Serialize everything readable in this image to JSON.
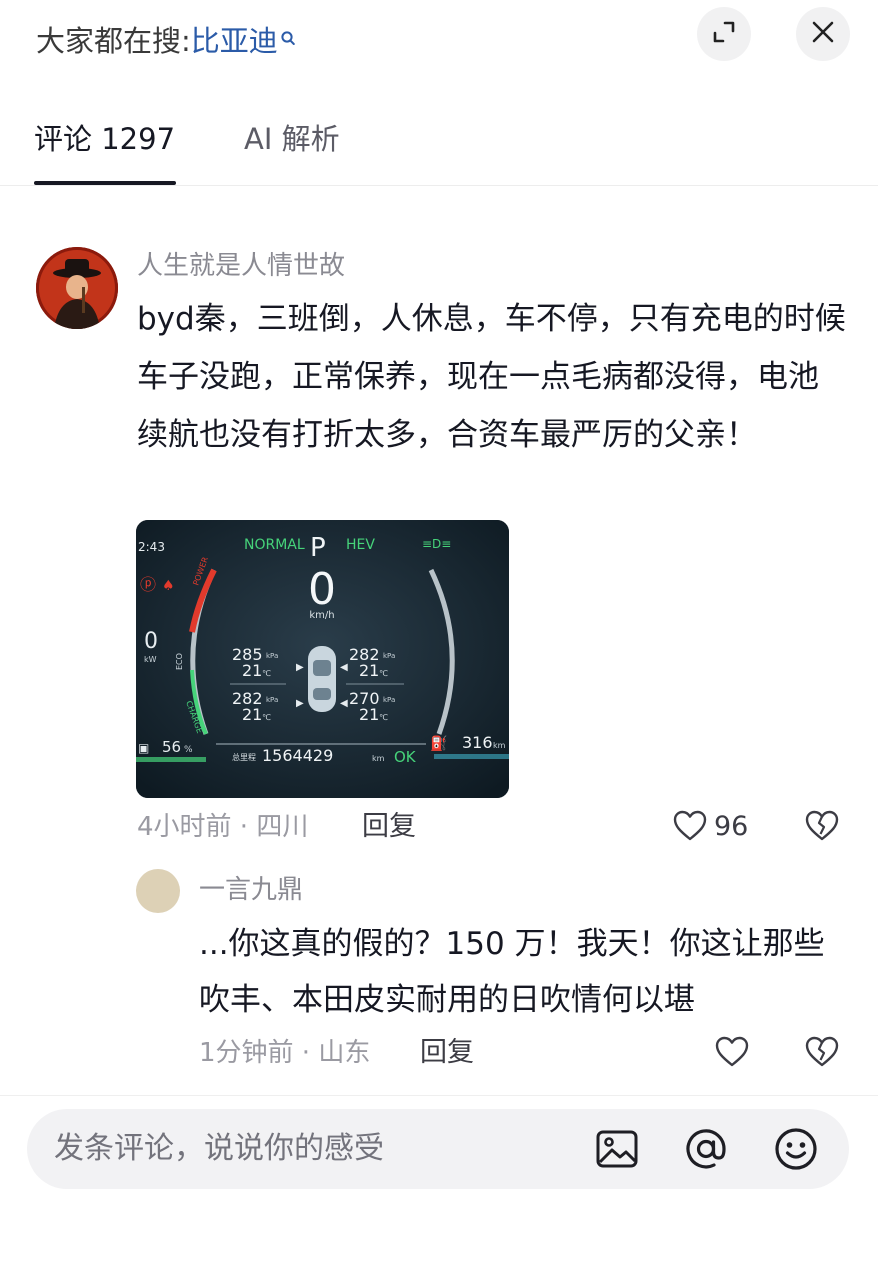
{
  "header": {
    "search_prefix": "大家都在搜:",
    "search_keyword": "比亚迪",
    "icons": [
      "search-icon",
      "expand-icon",
      "close-icon"
    ]
  },
  "tabs": [
    {
      "label": "评论 1297",
      "active": true
    },
    {
      "label": "AI 解析",
      "active": false
    }
  ],
  "comment": {
    "author": "人生就是人情世故",
    "text": "byd秦，三班倒，人休息，车不停，只有充电的时候车子没跑，正常保养，现在一点毛病都没得，电池续航也没有打折太多，合资车最严厉的父亲！",
    "meta": "4小时前 · 四川",
    "reply_label": "回复",
    "likes": "96",
    "dashboard": {
      "time": "2:43",
      "mode_left": "NORMAL",
      "gear": "P",
      "mode_right": "HEV",
      "speed": "0",
      "speed_unit": "km/h",
      "power": "0",
      "power_unit": "kW",
      "tires": [
        {
          "pressure": "285",
          "temp": "21"
        },
        {
          "pressure": "282",
          "temp": "21"
        },
        {
          "pressure": "282",
          "temp": "21"
        },
        {
          "pressure": "270",
          "temp": "21"
        }
      ],
      "pressure_unit": "kPa",
      "temp_unit": "℃",
      "battery": "56",
      "battery_unit": "%",
      "odometer_label": "总里程",
      "odometer": "1564429",
      "odometer_unit": "km",
      "status": "OK",
      "range": "316",
      "range_unit": "km",
      "gauge_labels": {
        "power": "POWER",
        "eco": "ECO",
        "charge": "CHARGE"
      },
      "colors": {
        "green": "#46d37a",
        "red": "#e23a2c",
        "bg": "#14222c"
      }
    }
  },
  "reply": {
    "author": "一言九鼎",
    "text": "...你这真的假的？150 万！我天！你这让那些吹丰、本田皮实耐用的日吹情何以堪",
    "meta": "1分钟前 · 山东",
    "reply_label": "回复"
  },
  "composer": {
    "placeholder": "发条评论，说说你的感受",
    "icons": [
      "image-icon",
      "at-icon",
      "emoji-icon"
    ]
  }
}
